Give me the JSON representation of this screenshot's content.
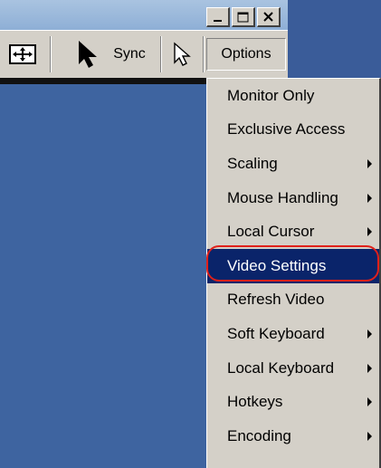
{
  "window": {
    "controls": [
      {
        "name": "minimize-icon"
      },
      {
        "name": "maximize-icon"
      },
      {
        "name": "close-icon"
      }
    ]
  },
  "toolbar": {
    "fit_icon": "fit-screen-icon",
    "cursor_icon": "cursor-icon",
    "sync_label": "Sync",
    "pointer_icon": "single-cursor-icon",
    "options_label": "Options"
  },
  "menu": {
    "items": [
      {
        "label": "Monitor Only",
        "submenu": false
      },
      {
        "label": "Exclusive Access",
        "submenu": false
      },
      {
        "label": "Scaling",
        "submenu": true
      },
      {
        "label": "Mouse Handling",
        "submenu": true
      },
      {
        "label": "Local Cursor",
        "submenu": true
      },
      {
        "label": "Video Settings",
        "submenu": false,
        "selected": true
      },
      {
        "label": "Refresh Video",
        "submenu": false
      },
      {
        "label": "Soft Keyboard",
        "submenu": true
      },
      {
        "label": "Local Keyboard",
        "submenu": true
      },
      {
        "label": "Hotkeys",
        "submenu": true
      },
      {
        "label": "Encoding",
        "submenu": true
      }
    ]
  },
  "colors": {
    "desktop": "#3e64a0",
    "menu_bg": "#d4d0c8",
    "selection": "#0a246a",
    "highlight_ring": "#e0201a"
  }
}
